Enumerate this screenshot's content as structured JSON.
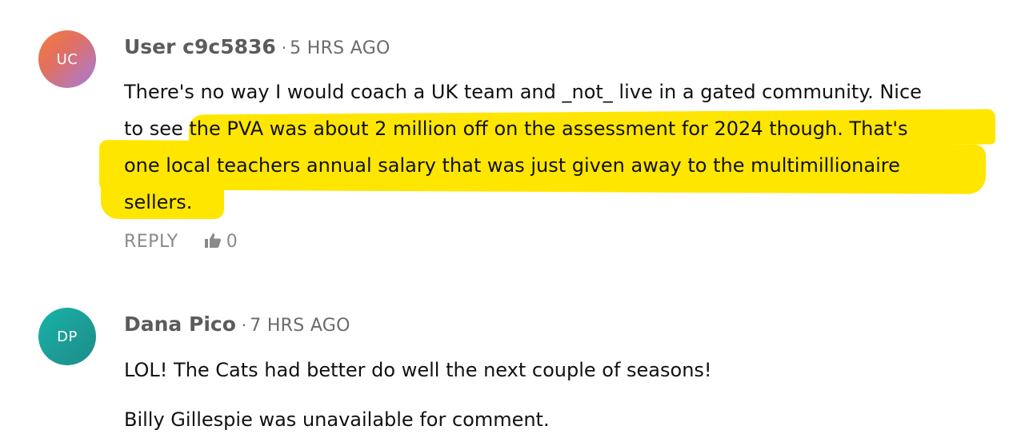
{
  "comments": [
    {
      "avatar_initials": "UC",
      "username": "User c9c5836",
      "separator": "·",
      "time": "5 HRS AGO",
      "lines": [
        "There's no way I would coach a UK team and _not_ live in a gated community. Nice",
        "to see the PVA was about 2 million off on the assessment for 2024 though. That's",
        "one local teachers annual salary that was just given away to the multimillionaire",
        "sellers."
      ],
      "reply_label": "REPLY",
      "like_count": "0",
      "highlight_color": "#ffe600"
    },
    {
      "avatar_initials": "DP",
      "username": "Dana Pico",
      "separator": "·",
      "time": "7 HRS AGO",
      "paragraphs": [
        "LOL! The Cats had better do well the next couple of seasons!",
        "Billy Gillespie was unavailable for comment."
      ]
    }
  ],
  "colors": {
    "username": "#5b5b5b",
    "meta": "#6b6b6b",
    "action": "#8a8a8a",
    "highlight": "#ffe600"
  },
  "icons": {
    "like": "thumbs-up-icon"
  }
}
